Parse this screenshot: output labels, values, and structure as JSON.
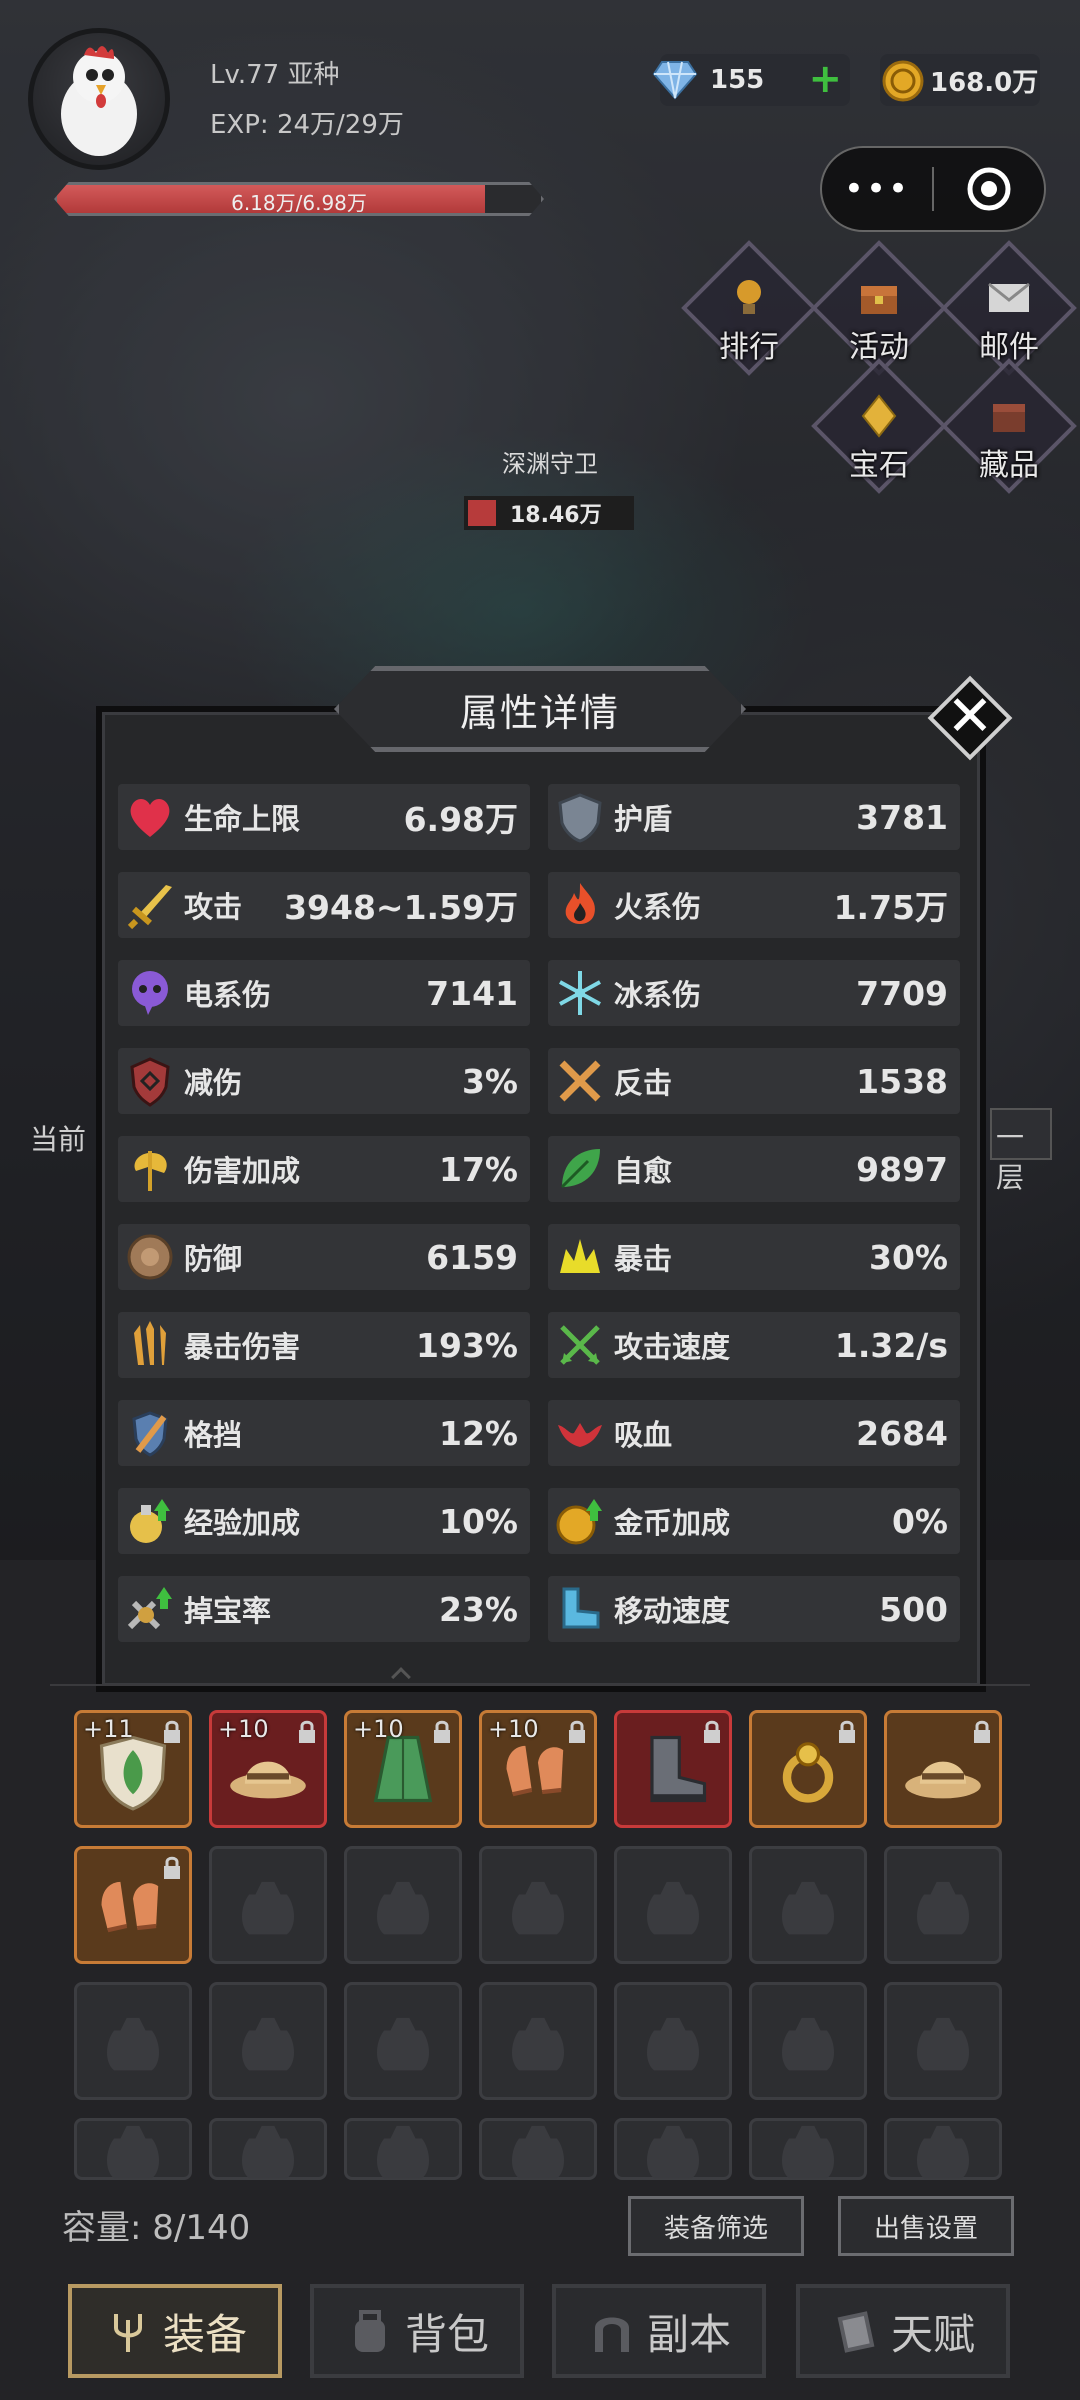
{
  "header": {
    "level_text": "Lv.77 亚种",
    "exp_text": "EXP: 24万/29万",
    "hp_text": "6.18万/6.98万",
    "hp_fraction": 0.885,
    "gems": "155",
    "gold": "168.0万"
  },
  "side_buttons": {
    "rank": "排行",
    "activity": "活动",
    "mail": "邮件",
    "gem": "宝石",
    "collection": "藏品"
  },
  "boss": {
    "name": "深渊守卫",
    "hp": "18.46万"
  },
  "background_labels": {
    "left": "当前",
    "right": "一层"
  },
  "modal": {
    "title": "属性详情",
    "stats": [
      {
        "name": "生命上限",
        "value": "6.98万",
        "icon": "heart-icon"
      },
      {
        "name": "护盾",
        "value": "3781",
        "icon": "shield-icon"
      },
      {
        "name": "攻击",
        "value": "3948~1.59万",
        "icon": "sword-icon"
      },
      {
        "name": "火系伤",
        "value": "1.75万",
        "icon": "fire-icon"
      },
      {
        "name": "电系伤",
        "value": "7141",
        "icon": "lightning-skull-icon"
      },
      {
        "name": "冰系伤",
        "value": "7709",
        "icon": "snowflake-icon"
      },
      {
        "name": "减伤",
        "value": "3%",
        "icon": "damage-reduction-shield-icon"
      },
      {
        "name": "反击",
        "value": "1538",
        "icon": "crossed-swords-icon"
      },
      {
        "name": "伤害加成",
        "value": "17%",
        "icon": "axe-icon"
      },
      {
        "name": "自愈",
        "value": "9897",
        "icon": "leaf-icon"
      },
      {
        "name": "防御",
        "value": "6159",
        "icon": "round-shield-icon"
      },
      {
        "name": "暴击",
        "value": "30%",
        "icon": "crit-burst-icon"
      },
      {
        "name": "暴击伤害",
        "value": "193%",
        "icon": "blades-icon"
      },
      {
        "name": "攻击速度",
        "value": "1.32/s",
        "icon": "crossed-arrows-icon"
      },
      {
        "name": "格挡",
        "value": "12%",
        "icon": "block-shield-sword-icon"
      },
      {
        "name": "吸血",
        "value": "2684",
        "icon": "bat-icon"
      },
      {
        "name": "经验加成",
        "value": "10%",
        "icon": "exp-potion-icon"
      },
      {
        "name": "金币加成",
        "value": "0%",
        "icon": "gold-coin-up-icon"
      },
      {
        "name": "掉宝率",
        "value": "23%",
        "icon": "loot-up-icon"
      },
      {
        "name": "移动速度",
        "value": "500",
        "icon": "boot-icon"
      }
    ]
  },
  "inventory": {
    "equipped": [
      {
        "plus": "+11",
        "item": "leaf-shield-icon",
        "rarity": "orange"
      },
      {
        "plus": "+10",
        "item": "straw-hat-icon",
        "rarity": "red"
      },
      {
        "plus": "+10",
        "item": "green-robe-icon",
        "rarity": "orange"
      },
      {
        "plus": "+10",
        "item": "gloves-icon",
        "rarity": "orange"
      },
      {
        "plus": "",
        "item": "boots-icon",
        "rarity": "red"
      },
      {
        "plus": "",
        "item": "ring-icon",
        "rarity": "orange"
      },
      {
        "plus": "",
        "item": "straw-hat-icon",
        "rarity": "orange"
      },
      {
        "plus": "",
        "item": "gloves-icon",
        "rarity": "orange"
      }
    ],
    "capacity": "容量: 8/140",
    "filter_button": "装备筛选",
    "sell_button": "出售设置"
  },
  "tabs": [
    {
      "label": "装备",
      "icon": "trident-icon",
      "active": true
    },
    {
      "label": "背包",
      "icon": "backpack-icon",
      "active": false
    },
    {
      "label": "副本",
      "icon": "dungeon-gate-icon",
      "active": false
    },
    {
      "label": "天赋",
      "icon": "talent-book-icon",
      "active": false
    }
  ]
}
